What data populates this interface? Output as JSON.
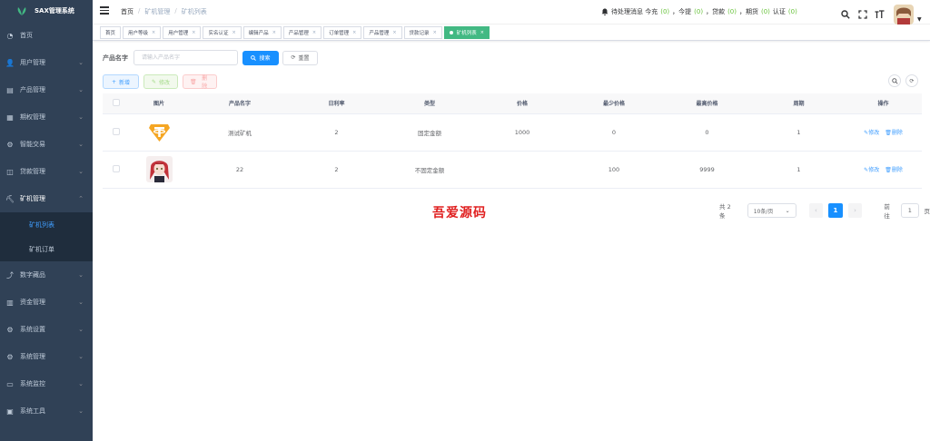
{
  "app": {
    "title": "SAX管理系统"
  },
  "sidebar": {
    "items": [
      {
        "label": "首页",
        "icon": "dashboard-icon",
        "has_children": false
      },
      {
        "label": "用户管理",
        "icon": "user-icon",
        "has_children": true
      },
      {
        "label": "产品管理",
        "icon": "product-icon",
        "has_children": true
      },
      {
        "label": "期权管理",
        "icon": "option-icon",
        "has_children": true
      },
      {
        "label": "智能交易",
        "icon": "gear-icon",
        "has_children": true
      },
      {
        "label": "贷款管理",
        "icon": "loan-icon",
        "has_children": true
      },
      {
        "label": "矿机管理",
        "icon": "mining-icon",
        "has_children": true,
        "open": true,
        "children": [
          {
            "label": "矿机列表",
            "active": true
          },
          {
            "label": "矿机订单",
            "active": false
          }
        ]
      },
      {
        "label": "数字藏品",
        "icon": "chart-icon",
        "has_children": true
      },
      {
        "label": "资金管理",
        "icon": "money-icon",
        "has_children": true
      },
      {
        "label": "系统设置",
        "icon": "settings-icon",
        "has_children": true
      },
      {
        "label": "系统管理",
        "icon": "system-icon",
        "has_children": true
      },
      {
        "label": "系统监控",
        "icon": "monitor-icon",
        "has_children": true
      },
      {
        "label": "系统工具",
        "icon": "tools-icon",
        "has_children": true
      }
    ]
  },
  "navbar": {
    "breadcrumb": [
      "首页",
      "矿机管理",
      "矿机列表"
    ],
    "notice": {
      "prefix": "待处理消息 今充",
      "items": [
        {
          "value": "(0)",
          "label": "，今提"
        },
        {
          "value": "(0)",
          "label": "，贷款"
        },
        {
          "value": "(0)",
          "label": "，期货"
        },
        {
          "value": "(0)",
          "label": "认证"
        },
        {
          "value": "(0)",
          "label": ""
        }
      ]
    }
  },
  "tags": [
    {
      "label": "首页",
      "closable": false,
      "active": false
    },
    {
      "label": "用户等级",
      "closable": true,
      "active": false
    },
    {
      "label": "用户管理",
      "closable": true,
      "active": false
    },
    {
      "label": "实名认证",
      "closable": true,
      "active": false
    },
    {
      "label": "编辑产品",
      "closable": true,
      "active": false
    },
    {
      "label": "产品管理",
      "closable": true,
      "active": false
    },
    {
      "label": "订单管理",
      "closable": true,
      "active": false
    },
    {
      "label": "产品管理",
      "closable": true,
      "active": false
    },
    {
      "label": "贷款记录",
      "closable": true,
      "active": false
    },
    {
      "label": "矿机列表",
      "closable": true,
      "active": true
    }
  ],
  "search": {
    "label": "产品名字",
    "placeholder": "请输入产品名字",
    "search_label": "搜索",
    "reset_label": "重置"
  },
  "actions": {
    "add": "新增",
    "edit": "修改",
    "delete": "删除"
  },
  "table": {
    "headers": [
      "图片",
      "产品名字",
      "日利率",
      "类型",
      "价格",
      "最少价格",
      "最高价格",
      "周期",
      "操作"
    ],
    "rows": [
      {
        "image": "tether-logo",
        "name": "测试矿机",
        "rate": "2",
        "type": "固定金额",
        "price": "1000",
        "min": "0",
        "max": "0",
        "cycle": "1"
      },
      {
        "image": "anime-avatar",
        "name": "22",
        "rate": "2",
        "type": "不固定金额",
        "price": "",
        "min": "100",
        "max": "9999",
        "cycle": "1"
      }
    ],
    "row_edit": "修改",
    "row_delete": "删除"
  },
  "pagination": {
    "total": "共 2 条",
    "page_size": "10条/页",
    "current_page": "1",
    "goto_prefix": "前往",
    "goto_value": "1",
    "goto_suffix": "页"
  },
  "watermark": "吾爱源码",
  "colors": {
    "sidebar_bg": "#304156",
    "primary": "#1890ff",
    "active_tag": "#42b983",
    "link": "#409eff",
    "watermark": "#e02020",
    "count_green": "#67c23a"
  }
}
